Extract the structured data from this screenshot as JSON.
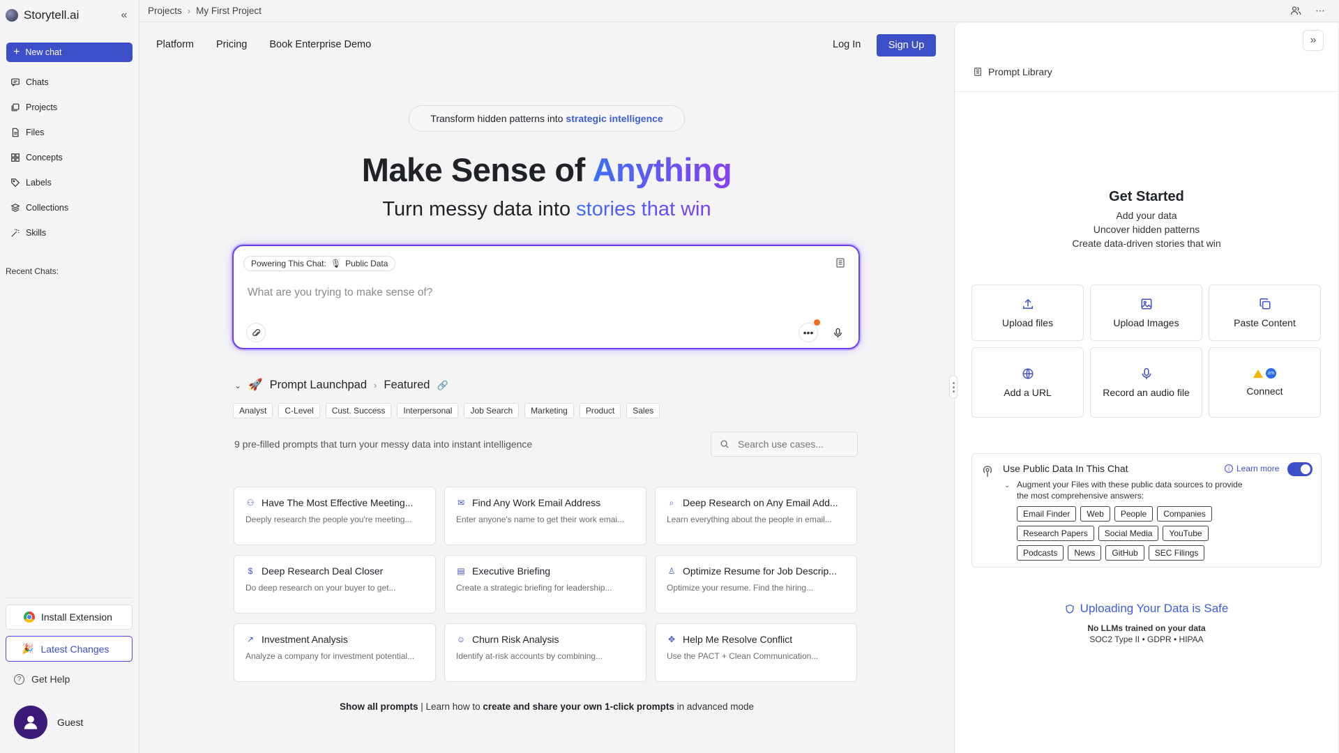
{
  "app": {
    "name": "Storytell.ai"
  },
  "sidebar": {
    "new_chat": "New chat",
    "items": [
      {
        "label": "Chats",
        "icon": "chat-icon"
      },
      {
        "label": "Projects",
        "icon": "projects-icon"
      },
      {
        "label": "Files",
        "icon": "file-icon"
      },
      {
        "label": "Concepts",
        "icon": "concepts-icon"
      },
      {
        "label": "Labels",
        "icon": "tag-icon"
      },
      {
        "label": "Collections",
        "icon": "layers-icon"
      },
      {
        "label": "Skills",
        "icon": "wand-icon"
      }
    ],
    "recent_label": "Recent Chats:",
    "install_extension": "Install Extension",
    "latest_changes": "Latest Changes",
    "get_help": "Get Help",
    "user_name": "Guest"
  },
  "breadcrumb": {
    "root": "Projects",
    "current": "My First Project"
  },
  "site_nav": {
    "links": [
      "Platform",
      "Pricing",
      "Book Enterprise Demo"
    ],
    "login": "Log In",
    "signup": "Sign Up"
  },
  "hero": {
    "pill_text": "Transform hidden patterns into",
    "pill_accent": "strategic intelligence",
    "title_plain": "Make Sense of",
    "title_accent": "Anything",
    "subtitle_plain": "Turn messy data into",
    "subtitle_accent": "stories that win"
  },
  "chatbox": {
    "powering_label": "Powering This Chat:",
    "powering_source": "Public Data",
    "placeholder": "What are you trying to make sense of?"
  },
  "launchpad": {
    "title": "Prompt Launchpad",
    "section": "Featured",
    "categories": [
      "Analyst",
      "C-Level",
      "Cust. Success",
      "Interpersonal",
      "Job Search",
      "Marketing",
      "Product",
      "Sales"
    ],
    "count_text": "9 pre-filled prompts that turn your messy data into instant intelligence",
    "search_placeholder": "Search use cases...",
    "cards": [
      {
        "title": "Have The Most Effective Meeting...",
        "desc": "Deeply research the people you're meeting...",
        "icon": "people-icon"
      },
      {
        "title": "Find Any Work Email Address",
        "desc": "Enter anyone's name to get their work emai...",
        "icon": "mail-icon"
      },
      {
        "title": "Deep Research on Any Email Add...",
        "desc": "Learn everything about the people in email...",
        "icon": "search-icon"
      },
      {
        "title": "Deep Research Deal Closer",
        "desc": "Do deep research on your buyer to get...",
        "icon": "dollar-icon"
      },
      {
        "title": "Executive Briefing",
        "desc": "Create a strategic briefing for leadership...",
        "icon": "document-icon"
      },
      {
        "title": "Optimize Resume for Job Descrip...",
        "desc": "Optimize your resume. Find the hiring...",
        "icon": "thumb-icon"
      },
      {
        "title": "Investment Analysis",
        "desc": "Analyze a company for investment potential...",
        "icon": "trend-icon"
      },
      {
        "title": "Churn Risk Analysis",
        "desc": "Identify at-risk accounts by combining...",
        "icon": "smile-icon"
      },
      {
        "title": "Help Me Resolve Conflict",
        "desc": "Use the PACT + Clean Communication...",
        "icon": "handshake-icon"
      }
    ],
    "footer_bold1": "Show all prompts",
    "footer_mid": " | Learn how to ",
    "footer_bold2": "create and share your own 1-click prompts",
    "footer_end": " in advanced mode"
  },
  "right_panel": {
    "prompt_library": "Prompt Library",
    "get_started_title": "Get Started",
    "get_started_lines": [
      "Add your data",
      "Uncover hidden patterns",
      "Create data-driven stories that win"
    ],
    "actions": [
      {
        "label": "Upload files",
        "icon": "upload-icon"
      },
      {
        "label": "Upload Images",
        "icon": "image-icon"
      },
      {
        "label": "Paste Content",
        "icon": "copy-icon"
      },
      {
        "label": "Add a URL",
        "icon": "globe-icon"
      },
      {
        "label": "Record an audio file",
        "icon": "mic-icon"
      },
      {
        "label": "Connect",
        "icon": "connect-icon"
      }
    ],
    "public_data": {
      "title": "Use Public Data In This Chat",
      "learn_more": "Learn more",
      "enabled": true,
      "description": "Augment your Files with these public data sources to provide the most comprehensive answers:",
      "sources": [
        "Email Finder",
        "Web",
        "People",
        "Companies",
        "Research Papers",
        "Social Media",
        "YouTube",
        "Podcasts",
        "News",
        "GitHub",
        "SEC Filings"
      ]
    },
    "safe": {
      "title": "Uploading Your Data is Safe",
      "line1": "No LLMs trained on your data",
      "line2": "SOC2 Type II • GDPR • HIPAA"
    }
  },
  "colors": {
    "primary": "#3d4ec9",
    "accent_gradient_start": "#3b6ff5",
    "accent_gradient_end": "#8a3ff0",
    "notification": "#f26a1b"
  }
}
